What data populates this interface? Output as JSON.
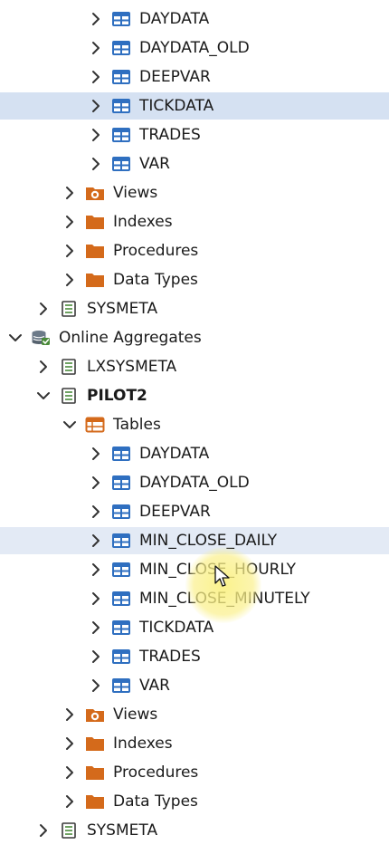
{
  "tree": [
    {
      "label": "DAYDATA",
      "icon": "table-icon",
      "chevron": "right"
    },
    {
      "label": "DAYDATA_OLD",
      "icon": "table-icon",
      "chevron": "right"
    },
    {
      "label": "DEEPVAR",
      "icon": "table-icon",
      "chevron": "right"
    },
    {
      "label": "TICKDATA",
      "icon": "table-icon",
      "chevron": "right"
    },
    {
      "label": "TRADES",
      "icon": "table-icon",
      "chevron": "right"
    },
    {
      "label": "VAR",
      "icon": "table-icon",
      "chevron": "right"
    },
    {
      "label": "Views",
      "icon": "views-icon",
      "chevron": "right"
    },
    {
      "label": "Indexes",
      "icon": "folder-icon",
      "chevron": "right"
    },
    {
      "label": "Procedures",
      "icon": "folder-icon",
      "chevron": "right"
    },
    {
      "label": "Data Types",
      "icon": "folder-icon",
      "chevron": "right"
    },
    {
      "label": "SYSMETA",
      "icon": "schema-icon",
      "chevron": "right"
    },
    {
      "label": "Online Aggregates",
      "icon": "database-icon",
      "chevron": "down"
    },
    {
      "label": "LXSYSMETA",
      "icon": "schema-icon",
      "chevron": "right"
    },
    {
      "label": "PILOT2",
      "icon": "schema-icon",
      "chevron": "down"
    },
    {
      "label": "Tables",
      "icon": "tables-folder-icon",
      "chevron": "down"
    },
    {
      "label": "DAYDATA",
      "icon": "table-icon",
      "chevron": "right"
    },
    {
      "label": "DAYDATA_OLD",
      "icon": "table-icon",
      "chevron": "right"
    },
    {
      "label": "DEEPVAR",
      "icon": "table-icon",
      "chevron": "right"
    },
    {
      "label": "MIN_CLOSE_DAILY",
      "icon": "table-icon",
      "chevron": "right"
    },
    {
      "label": "MIN_CLOSE_HOURLY",
      "icon": "table-icon",
      "chevron": "right"
    },
    {
      "label": "MIN_CLOSE_MINUTELY",
      "icon": "table-icon",
      "chevron": "right"
    },
    {
      "label": "TICKDATA",
      "icon": "table-icon",
      "chevron": "right"
    },
    {
      "label": "TRADES",
      "icon": "table-icon",
      "chevron": "right"
    },
    {
      "label": "VAR",
      "icon": "table-icon",
      "chevron": "right"
    },
    {
      "label": "Views",
      "icon": "views-icon",
      "chevron": "right"
    },
    {
      "label": "Indexes",
      "icon": "folder-icon",
      "chevron": "right"
    },
    {
      "label": "Procedures",
      "icon": "folder-icon",
      "chevron": "right"
    },
    {
      "label": "Data Types",
      "icon": "folder-icon",
      "chevron": "right"
    },
    {
      "label": "SYSMETA",
      "icon": "schema-icon",
      "chevron": "right"
    }
  ],
  "colors": {
    "selected_row": "#d5e1f2",
    "hover_row": "#e3eaf5",
    "table_icon": "#2f6fc0",
    "folder_icon": "#d46a1b",
    "database_icon": "#4a8a3a"
  }
}
